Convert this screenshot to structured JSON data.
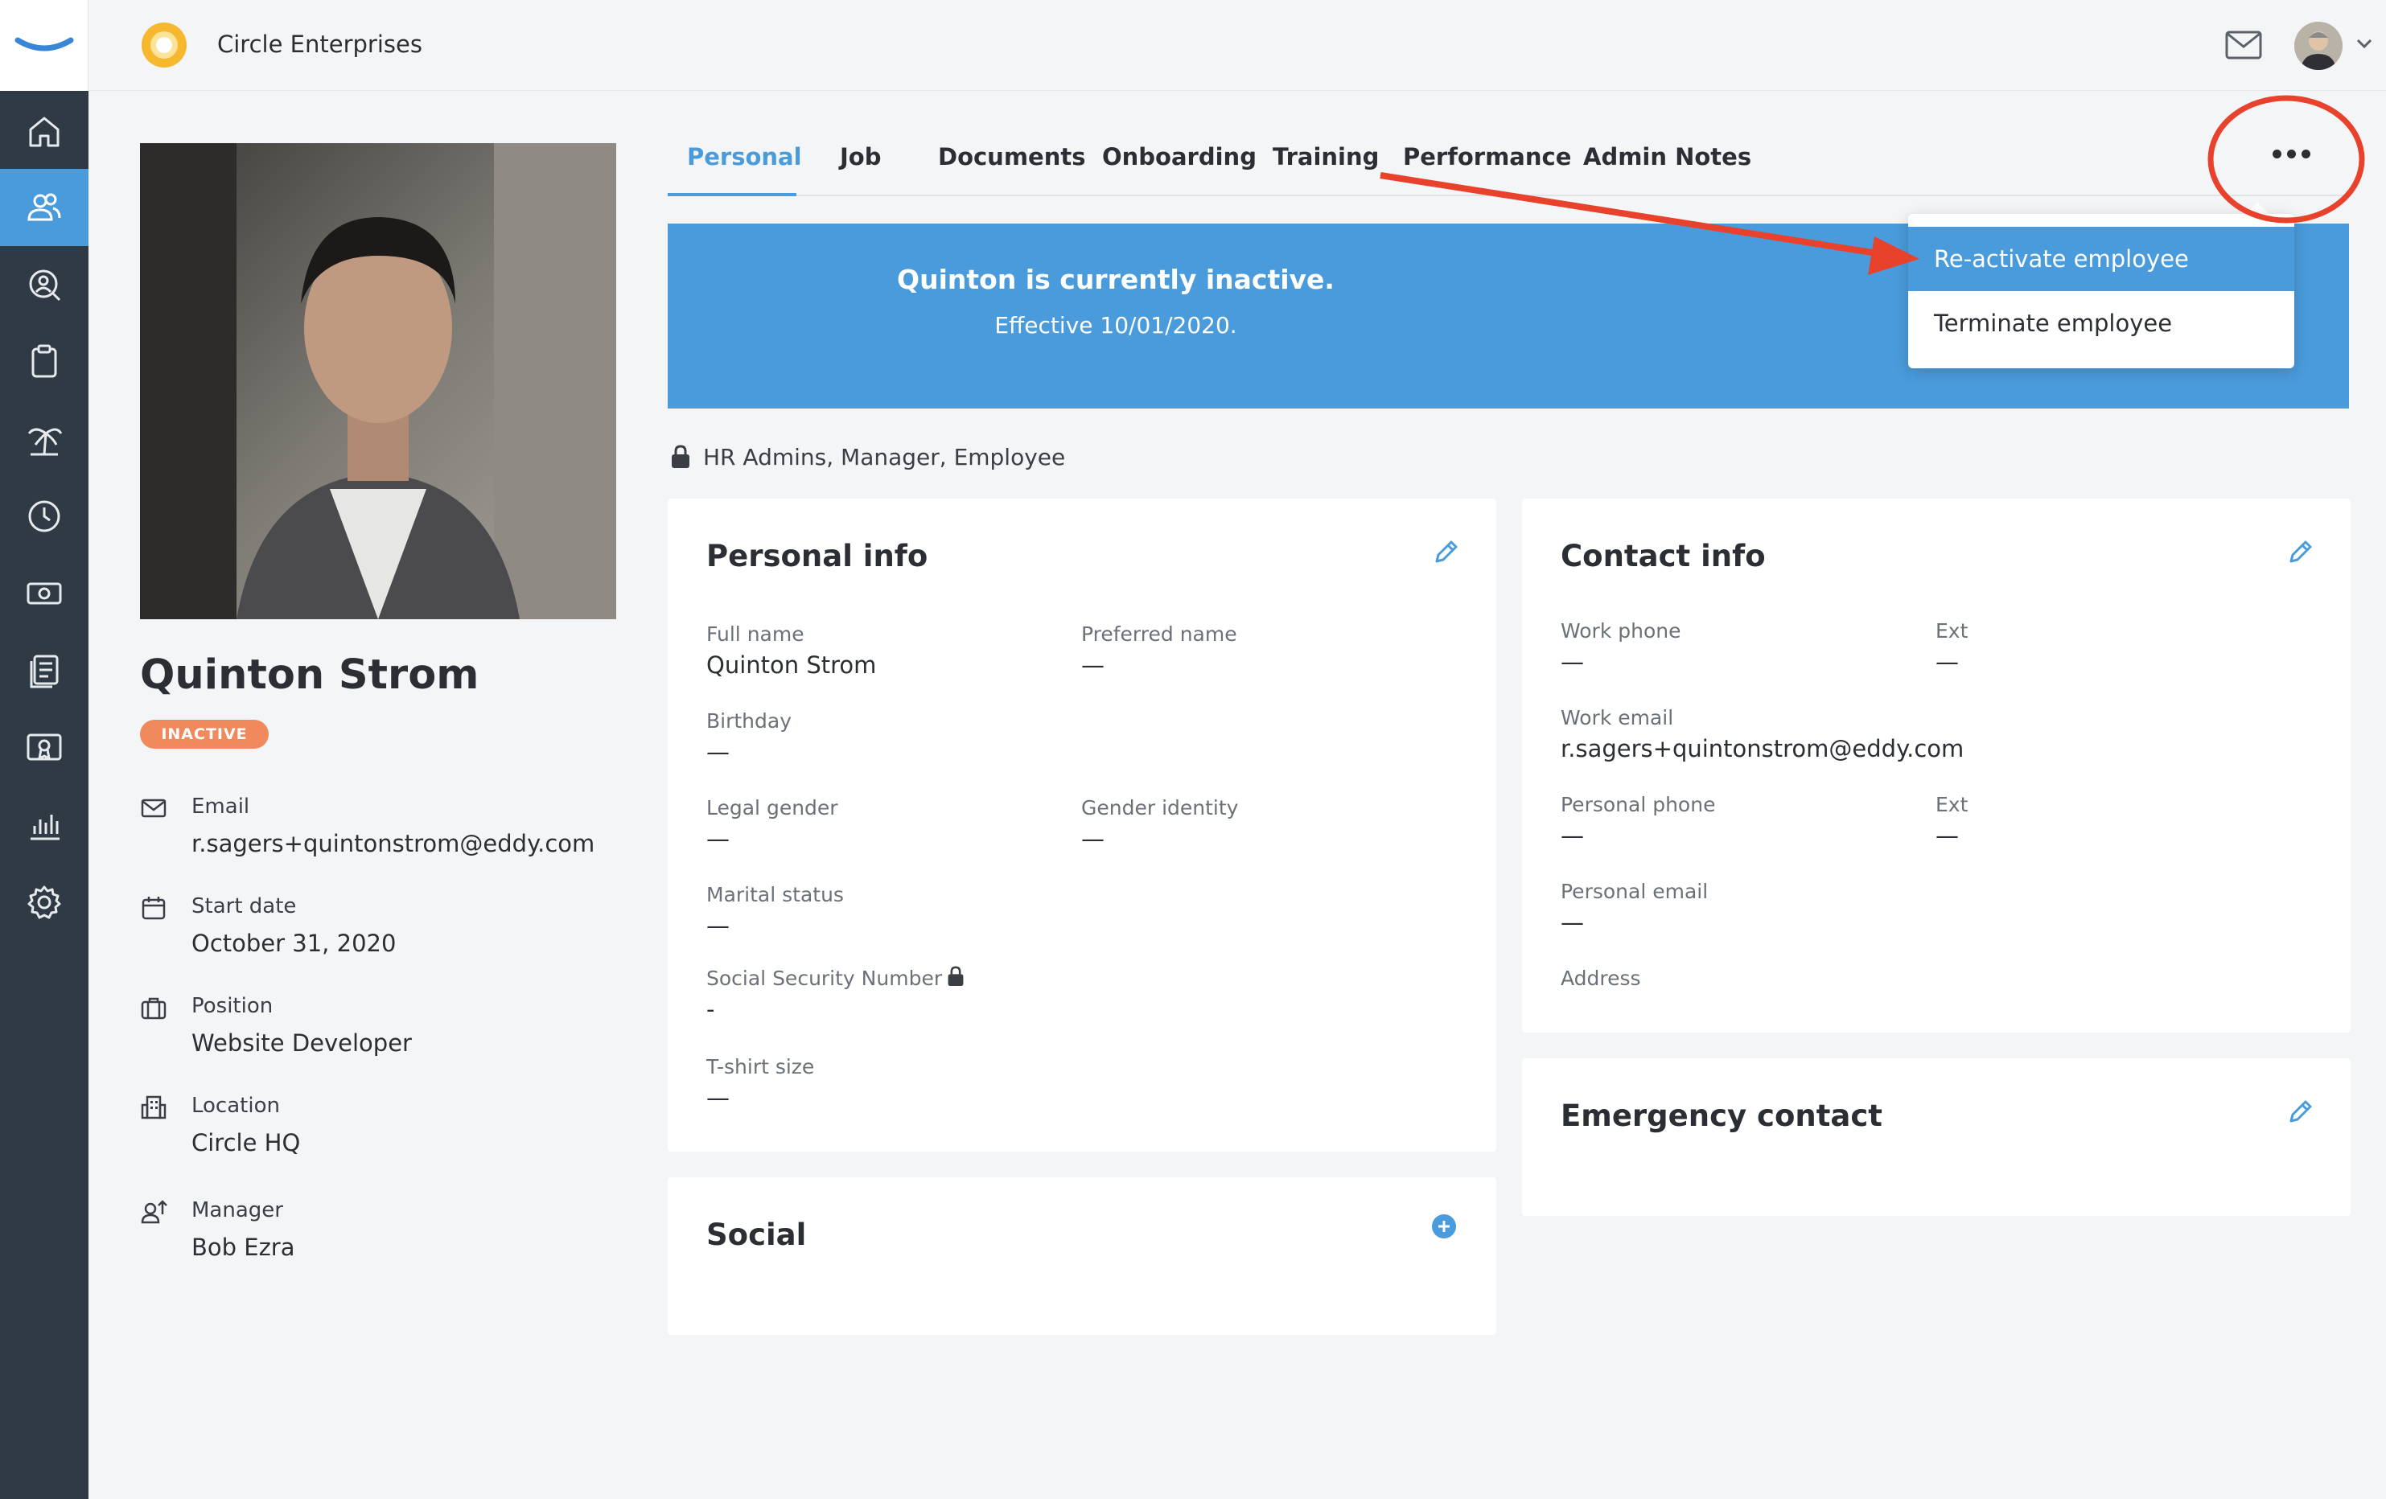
{
  "topbar": {
    "company_name": "Circle Enterprises",
    "mail_icon": "mail-icon",
    "avatar": "user-avatar"
  },
  "sidebar": {
    "items": [
      {
        "name": "home",
        "icon": "home-icon",
        "active": false
      },
      {
        "name": "people",
        "icon": "people-icon",
        "active": true
      },
      {
        "name": "hiring",
        "icon": "person-search-icon",
        "active": false
      },
      {
        "name": "tasks",
        "icon": "clipboard-icon",
        "active": false
      },
      {
        "name": "time-off",
        "icon": "palm-tree-icon",
        "active": false
      },
      {
        "name": "time",
        "icon": "clock-icon",
        "active": false
      },
      {
        "name": "payroll",
        "icon": "money-icon",
        "active": false
      },
      {
        "name": "documents",
        "icon": "documents-icon",
        "active": false
      },
      {
        "name": "training",
        "icon": "certificate-icon",
        "active": false
      },
      {
        "name": "reports",
        "icon": "bar-chart-icon",
        "active": false
      },
      {
        "name": "settings",
        "icon": "gear-icon",
        "active": false
      }
    ]
  },
  "profile": {
    "name": "Quinton Strom",
    "status": "INACTIVE",
    "email_label": "Email",
    "email": "r.sagers+quintonstrom@eddy.com",
    "start_label": "Start date",
    "start_date": "October 31, 2020",
    "position_label": "Position",
    "position": "Website Developer",
    "location_label": "Location",
    "location": "Circle HQ",
    "manager_label": "Manager",
    "manager": "Bob Ezra"
  },
  "tabs": [
    "Personal",
    "Job",
    "Documents",
    "Onboarding",
    "Training",
    "Performance",
    "Admin Notes"
  ],
  "banner": {
    "title": "Quinton is currently inactive.",
    "subtitle": "Effective 10/01/2020."
  },
  "menu": {
    "items": [
      "Re-activate employee",
      "Terminate employee"
    ]
  },
  "access": "HR Admins, Manager, Employee",
  "personal_info": {
    "title": "Personal info",
    "full_name_label": "Full name",
    "full_name": "Quinton Strom",
    "preferred_name_label": "Preferred name",
    "preferred_name": "—",
    "birthday_label": "Birthday",
    "birthday": "—",
    "legal_gender_label": "Legal gender",
    "legal_gender": "—",
    "gender_identity_label": "Gender identity",
    "gender_identity": "—",
    "marital_status_label": "Marital status",
    "marital_status": "—",
    "ssn_label": "Social Security Number",
    "ssn": "-",
    "tshirt_label": "T-shirt size",
    "tshirt": "—"
  },
  "contact_info": {
    "title": "Contact info",
    "work_phone_label": "Work phone",
    "work_phone": "—",
    "ext_label": "Ext",
    "work_ext": "—",
    "work_email_label": "Work email",
    "work_email": "r.sagers+quintonstrom@eddy.com",
    "personal_phone_label": "Personal phone",
    "personal_phone": "—",
    "personal_ext_label": "Ext",
    "personal_ext": "—",
    "personal_email_label": "Personal email",
    "personal_email": "—",
    "address_label": "Address"
  },
  "social": {
    "title": "Social"
  },
  "emergency": {
    "title": "Emergency contact"
  },
  "colors": {
    "accent": "#4a9bdb",
    "sidebar": "#2f3a44",
    "badge": "#f08a5d",
    "annotation": "#e8412c"
  }
}
